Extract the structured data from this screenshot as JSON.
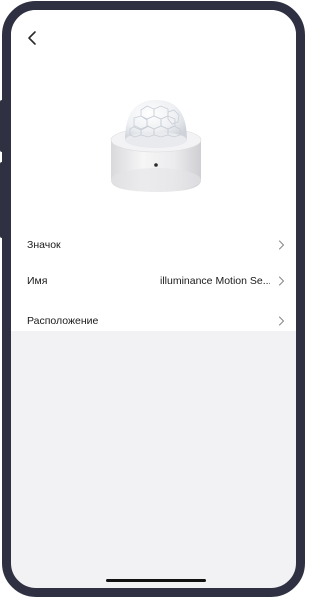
{
  "nav": {
    "back_icon": "chevron-left-icon"
  },
  "device": {
    "image": "motion-sensor-image"
  },
  "settings": {
    "rows": [
      {
        "label": "Значок",
        "value": ""
      },
      {
        "label": "Имя",
        "value": "illuminance Motion Se..."
      },
      {
        "label": "Расположение",
        "value": ""
      }
    ]
  },
  "colors": {
    "frame": "#2f3142",
    "background_lower": "#f2f2f4",
    "background_upper": "#ffffff",
    "text": "#1a1a1a",
    "chevron": "#8a8a8a"
  }
}
